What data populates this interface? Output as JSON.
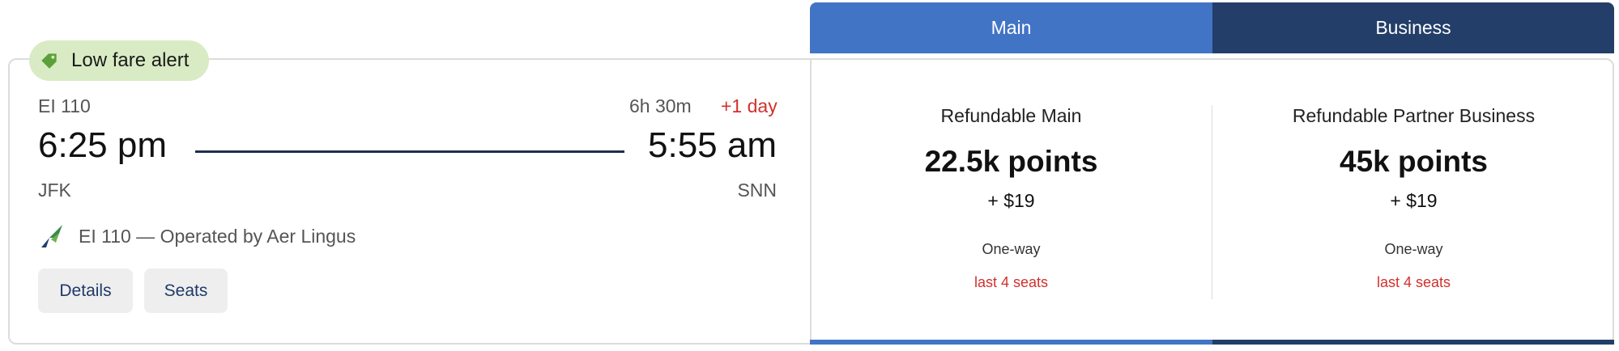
{
  "alert": {
    "label": "Low fare alert",
    "icon": "tag-icon",
    "color": "#d9ebc4"
  },
  "flight": {
    "number": "EI 110",
    "duration": "6h 30m",
    "day_offset": "+1 day",
    "departure_time": "6:25 pm",
    "arrival_time": "5:55 am",
    "departure_code": "JFK",
    "arrival_code": "SNN",
    "operated_by": "EI 110 — Operated by Aer Lingus",
    "airline_icon": "aer-lingus-logo-icon"
  },
  "actions": {
    "details_label": "Details",
    "seats_label": "Seats"
  },
  "tabs": [
    {
      "label": "Main",
      "color": "#4274c6"
    },
    {
      "label": "Business",
      "color": "#233f69"
    }
  ],
  "fares": [
    {
      "title": "Refundable Main",
      "points": "22.5k points",
      "cash": "+ $19",
      "trip": "One-way",
      "availability": "last 4 seats"
    },
    {
      "title": "Refundable Partner Business",
      "points": "45k points",
      "cash": "+ $19",
      "trip": "One-way",
      "availability": "last 4 seats"
    }
  ],
  "colors": {
    "alert_red": "#d0312d",
    "link_blue": "#1f3a68"
  }
}
